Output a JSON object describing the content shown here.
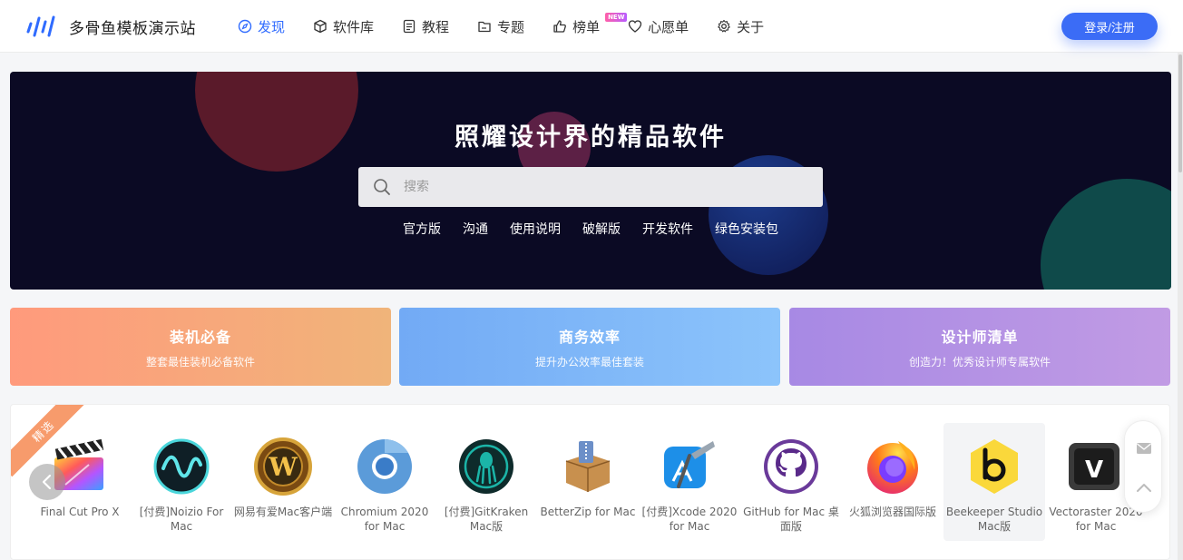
{
  "header": {
    "site_name": "多骨鱼模板演示站",
    "nav": [
      {
        "label": "发现",
        "icon": "compass-icon",
        "active": true
      },
      {
        "label": "软件库",
        "icon": "box-icon"
      },
      {
        "label": "教程",
        "icon": "document-icon"
      },
      {
        "label": "专题",
        "icon": "folder-icon"
      },
      {
        "label": "榜单",
        "icon": "thumbs-up-icon",
        "badge": "NEW"
      },
      {
        "label": "心愿单",
        "icon": "heart-icon"
      },
      {
        "label": "关于",
        "icon": "gear-icon"
      }
    ],
    "login_label": "登录/注册"
  },
  "hero": {
    "title": "照耀设计界的精品软件",
    "search_placeholder": "搜索",
    "tags": [
      "官方版",
      "沟通",
      "使用说明",
      "破解版",
      "开发软件",
      "绿色安装包"
    ]
  },
  "categories": [
    {
      "title": "装机必备",
      "subtitle": "整套最佳装机必备软件"
    },
    {
      "title": "商务效率",
      "subtitle": "提升办公效率最佳套装"
    },
    {
      "title": "设计师清单",
      "subtitle": "创造力！优秀设计师专属软件"
    }
  ],
  "featured": {
    "ribbon": "精选",
    "apps": [
      {
        "name": "Final Cut Pro X",
        "icon": "final-cut-pro-icon"
      },
      {
        "name": "[付费]Noizio For Mac",
        "icon": "noizio-icon"
      },
      {
        "name": "网易有爱Mac客户端",
        "icon": "warcraft-icon"
      },
      {
        "name": "Chromium 2020 for Mac",
        "icon": "chromium-icon"
      },
      {
        "name": "[付费]GitKraken Mac版",
        "icon": "gitkraken-icon"
      },
      {
        "name": "BetterZip for Mac",
        "icon": "betterzip-icon"
      },
      {
        "name": "[付费]Xcode 2020 for Mac",
        "icon": "xcode-icon"
      },
      {
        "name": "GitHub for Mac 桌面版",
        "icon": "github-icon"
      },
      {
        "name": "火狐浏览器国际版",
        "icon": "firefox-icon"
      },
      {
        "name": "Beekeeper Studio Mac版",
        "icon": "beekeeper-icon",
        "highlighted": true
      },
      {
        "name": "Vectoraster 2020 for Mac",
        "icon": "vectoraster-icon"
      }
    ]
  },
  "colors": {
    "accent": "#3b6cf6",
    "hero_bg": "#0b0a24",
    "ribbon": "#f79b6c"
  }
}
